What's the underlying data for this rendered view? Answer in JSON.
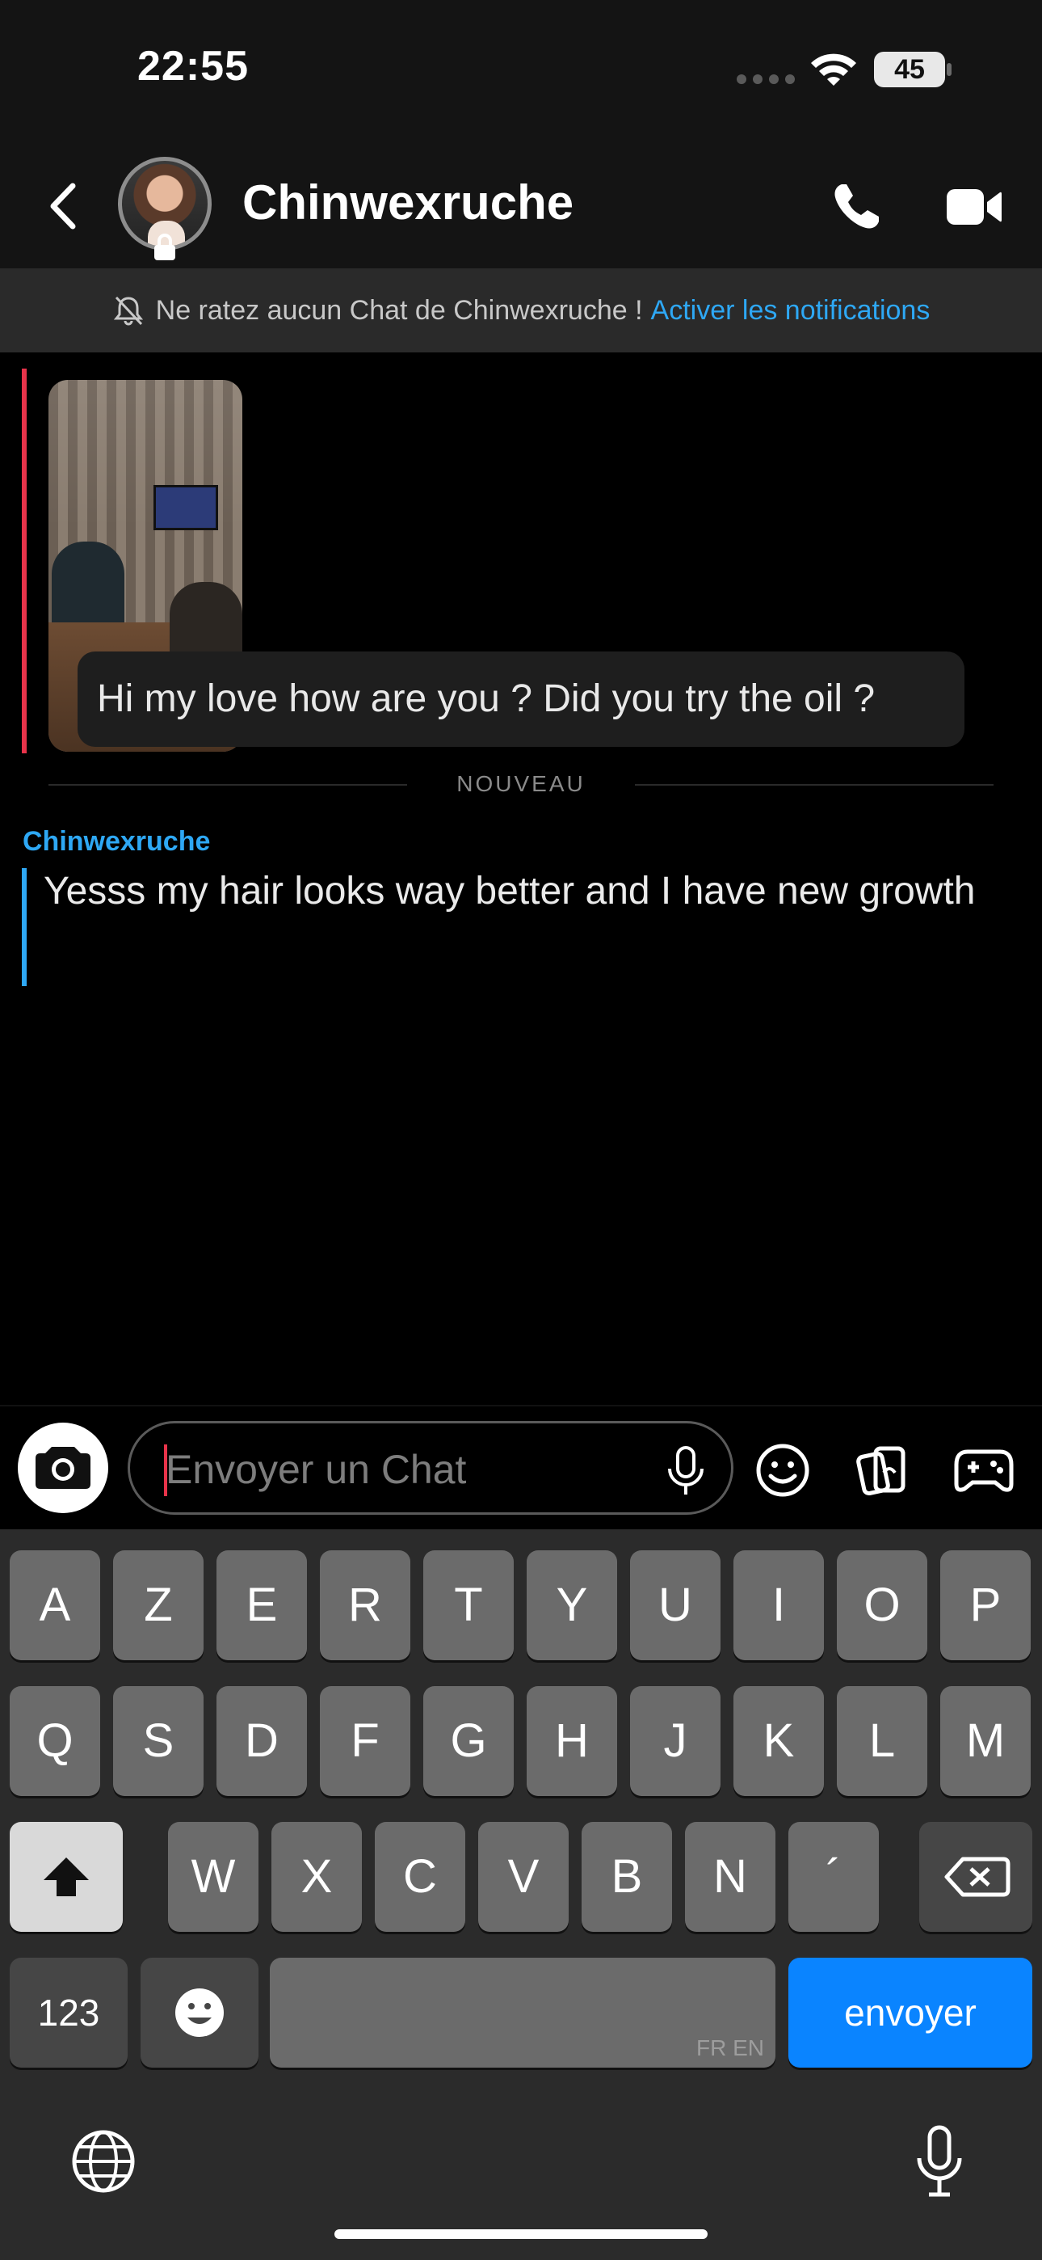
{
  "status_bar": {
    "time": "22:55",
    "battery": "45",
    "icons": [
      "signal-dots-icon",
      "wifi-icon",
      "battery-icon"
    ]
  },
  "header": {
    "contact_name": "Chinwexruche",
    "icons": [
      "back-chevron-icon",
      "avatar",
      "lock-icon",
      "phone-icon",
      "video-camera-icon"
    ]
  },
  "notification_bar": {
    "text": "Ne ratez aucun Chat de Chinwexruche !",
    "link": "Activer les notifications",
    "icon": "bell-off-icon"
  },
  "chat": {
    "quoted_message": "Hi my love how are you ? Did you try the oil ?",
    "divider_label": "NOUVEAU",
    "sender": "Chinwexruche",
    "message": "Yesss my hair looks way better and I have new growth"
  },
  "input_bar": {
    "placeholder": "Envoyer un Chat",
    "value": "",
    "icons": [
      "camera-icon",
      "microphone-icon",
      "smiley-icon",
      "memories-cards-icon",
      "gamepad-icon"
    ]
  },
  "keyboard": {
    "row1": [
      "A",
      "Z",
      "E",
      "R",
      "T",
      "Y",
      "U",
      "I",
      "O",
      "P"
    ],
    "row2": [
      "Q",
      "S",
      "D",
      "F",
      "G",
      "H",
      "J",
      "K",
      "L",
      "M"
    ],
    "row3": [
      "W",
      "X",
      "C",
      "V",
      "B",
      "N",
      "´"
    ],
    "numbers_label": "123",
    "space_languages": "FR EN",
    "send_label": "envoyer",
    "icons": [
      "shift-icon",
      "backspace-icon",
      "emoji-icon",
      "globe-icon",
      "dictation-mic-icon"
    ]
  },
  "colors": {
    "accent_blue": "#2ea8f5",
    "send_blue": "#0a84ff",
    "snap_red": "#e8334a"
  }
}
